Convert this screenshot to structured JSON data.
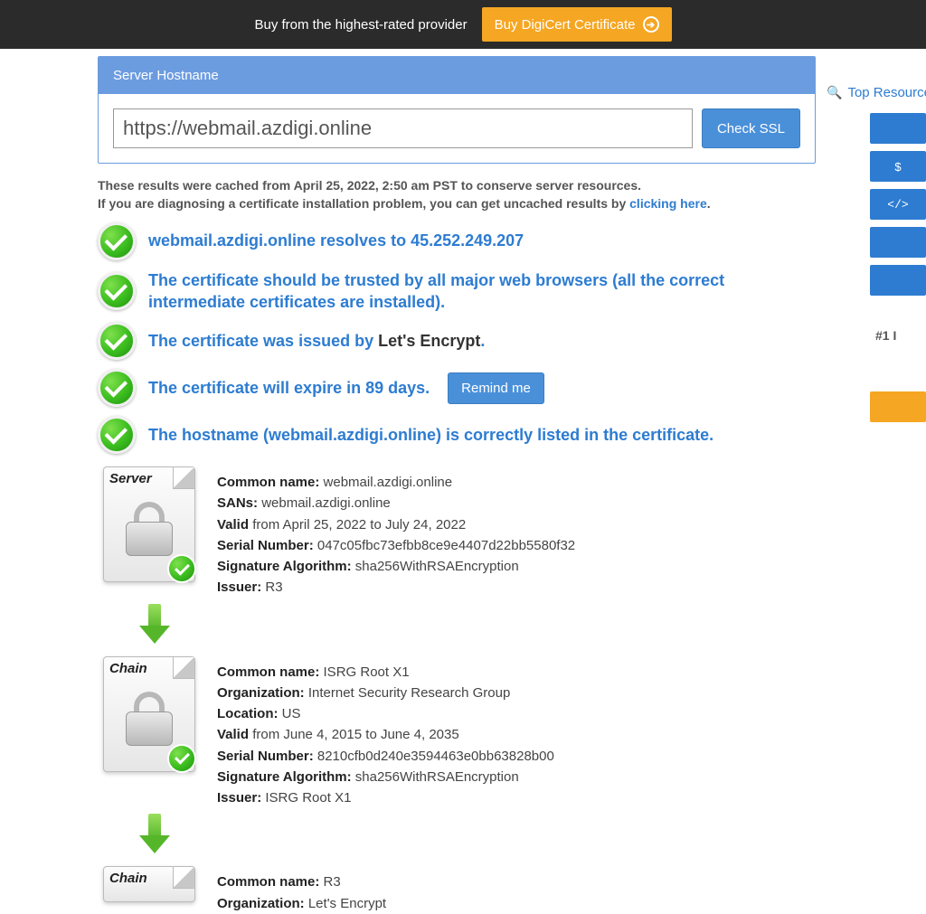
{
  "topbar": {
    "text": "Buy from the highest-rated provider",
    "button": "Buy DigiCert Certificate"
  },
  "card": {
    "header": "Server Hostname",
    "input_value": "https://webmail.azdigi.online",
    "check_button": "Check SSL"
  },
  "cache_note": {
    "line1_a": "These results were cached from ",
    "line1_date": "April 25, 2022, 2:50 am PST",
    "line1_b": " to conserve server resources.",
    "line2_a": "If you are diagnosing a certificate installation problem, you can get uncached results by ",
    "link": "clicking here",
    "line2_b": "."
  },
  "status": [
    {
      "text_a": "webmail.azdigi.online resolves to 45.252.249.207",
      "text_b": ""
    },
    {
      "text_a": "The certificate should be trusted by all major web browsers (all the correct intermediate certificates are installed).",
      "text_b": ""
    },
    {
      "text_a": "The certificate was issued by ",
      "plain": "Let's Encrypt",
      "text_b": "."
    },
    {
      "text_a": "The certificate will expire in 89 days.",
      "remind": "Remind me"
    },
    {
      "text_a": "The hostname (webmail.azdigi.online) is correctly listed in the certificate."
    }
  ],
  "certs": [
    {
      "label": "Server",
      "cn_label": "Common name:",
      "cn": "webmail.azdigi.online",
      "sans_label": "SANs:",
      "sans": "webmail.azdigi.online",
      "valid_label": "Valid",
      "valid": "from April 25, 2022 to July 24, 2022",
      "serial_label": "Serial Number:",
      "serial": "047c05fbc73efbb8ce9e4407d22bb5580f32",
      "sig_label": "Signature Algorithm:",
      "sig": "sha256WithRSAEncryption",
      "issuer_label": "Issuer:",
      "issuer": "R3"
    },
    {
      "label": "Chain",
      "cn_label": "Common name:",
      "cn": "ISRG Root X1",
      "org_label": "Organization:",
      "org": "Internet Security Research Group",
      "loc_label": "Location:",
      "loc": "US",
      "valid_label": "Valid",
      "valid": "from June 4, 2015 to June 4, 2035",
      "serial_label": "Serial Number:",
      "serial": "8210cfb0d240e3594463e0bb63828b00",
      "sig_label": "Signature Algorithm:",
      "sig": "sha256WithRSAEncryption",
      "issuer_label": "Issuer:",
      "issuer": "ISRG Root X1"
    },
    {
      "label": "Chain",
      "cn_label": "Common name:",
      "cn": "R3",
      "org_label": "Organization:",
      "org": "Let's Encrypt"
    }
  ],
  "sidebar": {
    "heading": "Top Resources",
    "items": [
      "",
      "$",
      "</>",
      "",
      ""
    ],
    "rank": "#1 I"
  }
}
